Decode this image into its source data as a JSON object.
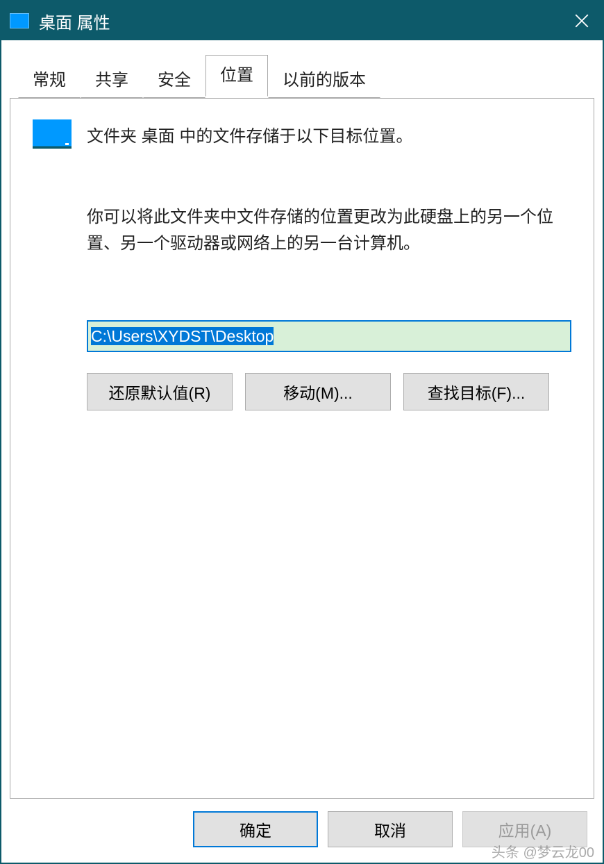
{
  "titlebar": {
    "title": "桌面 属性"
  },
  "tabs": {
    "general": "常规",
    "share": "共享",
    "security": "安全",
    "location": "位置",
    "previous": "以前的版本"
  },
  "location_tab": {
    "header": "文件夹 桌面 中的文件存储于以下目标位置。",
    "description": "你可以将此文件夹中文件存储的位置更改为此硬盘上的另一个位置、另一个驱动器或网络上的另一台计算机。",
    "path_value": "C:\\Users\\XYDST\\Desktop",
    "buttons": {
      "restore": "还原默认值(R)",
      "move": "移动(M)...",
      "find": "查找目标(F)..."
    }
  },
  "dialog_buttons": {
    "ok": "确定",
    "cancel": "取消",
    "apply": "应用(A)"
  },
  "watermark": "头条 @梦云龙00"
}
